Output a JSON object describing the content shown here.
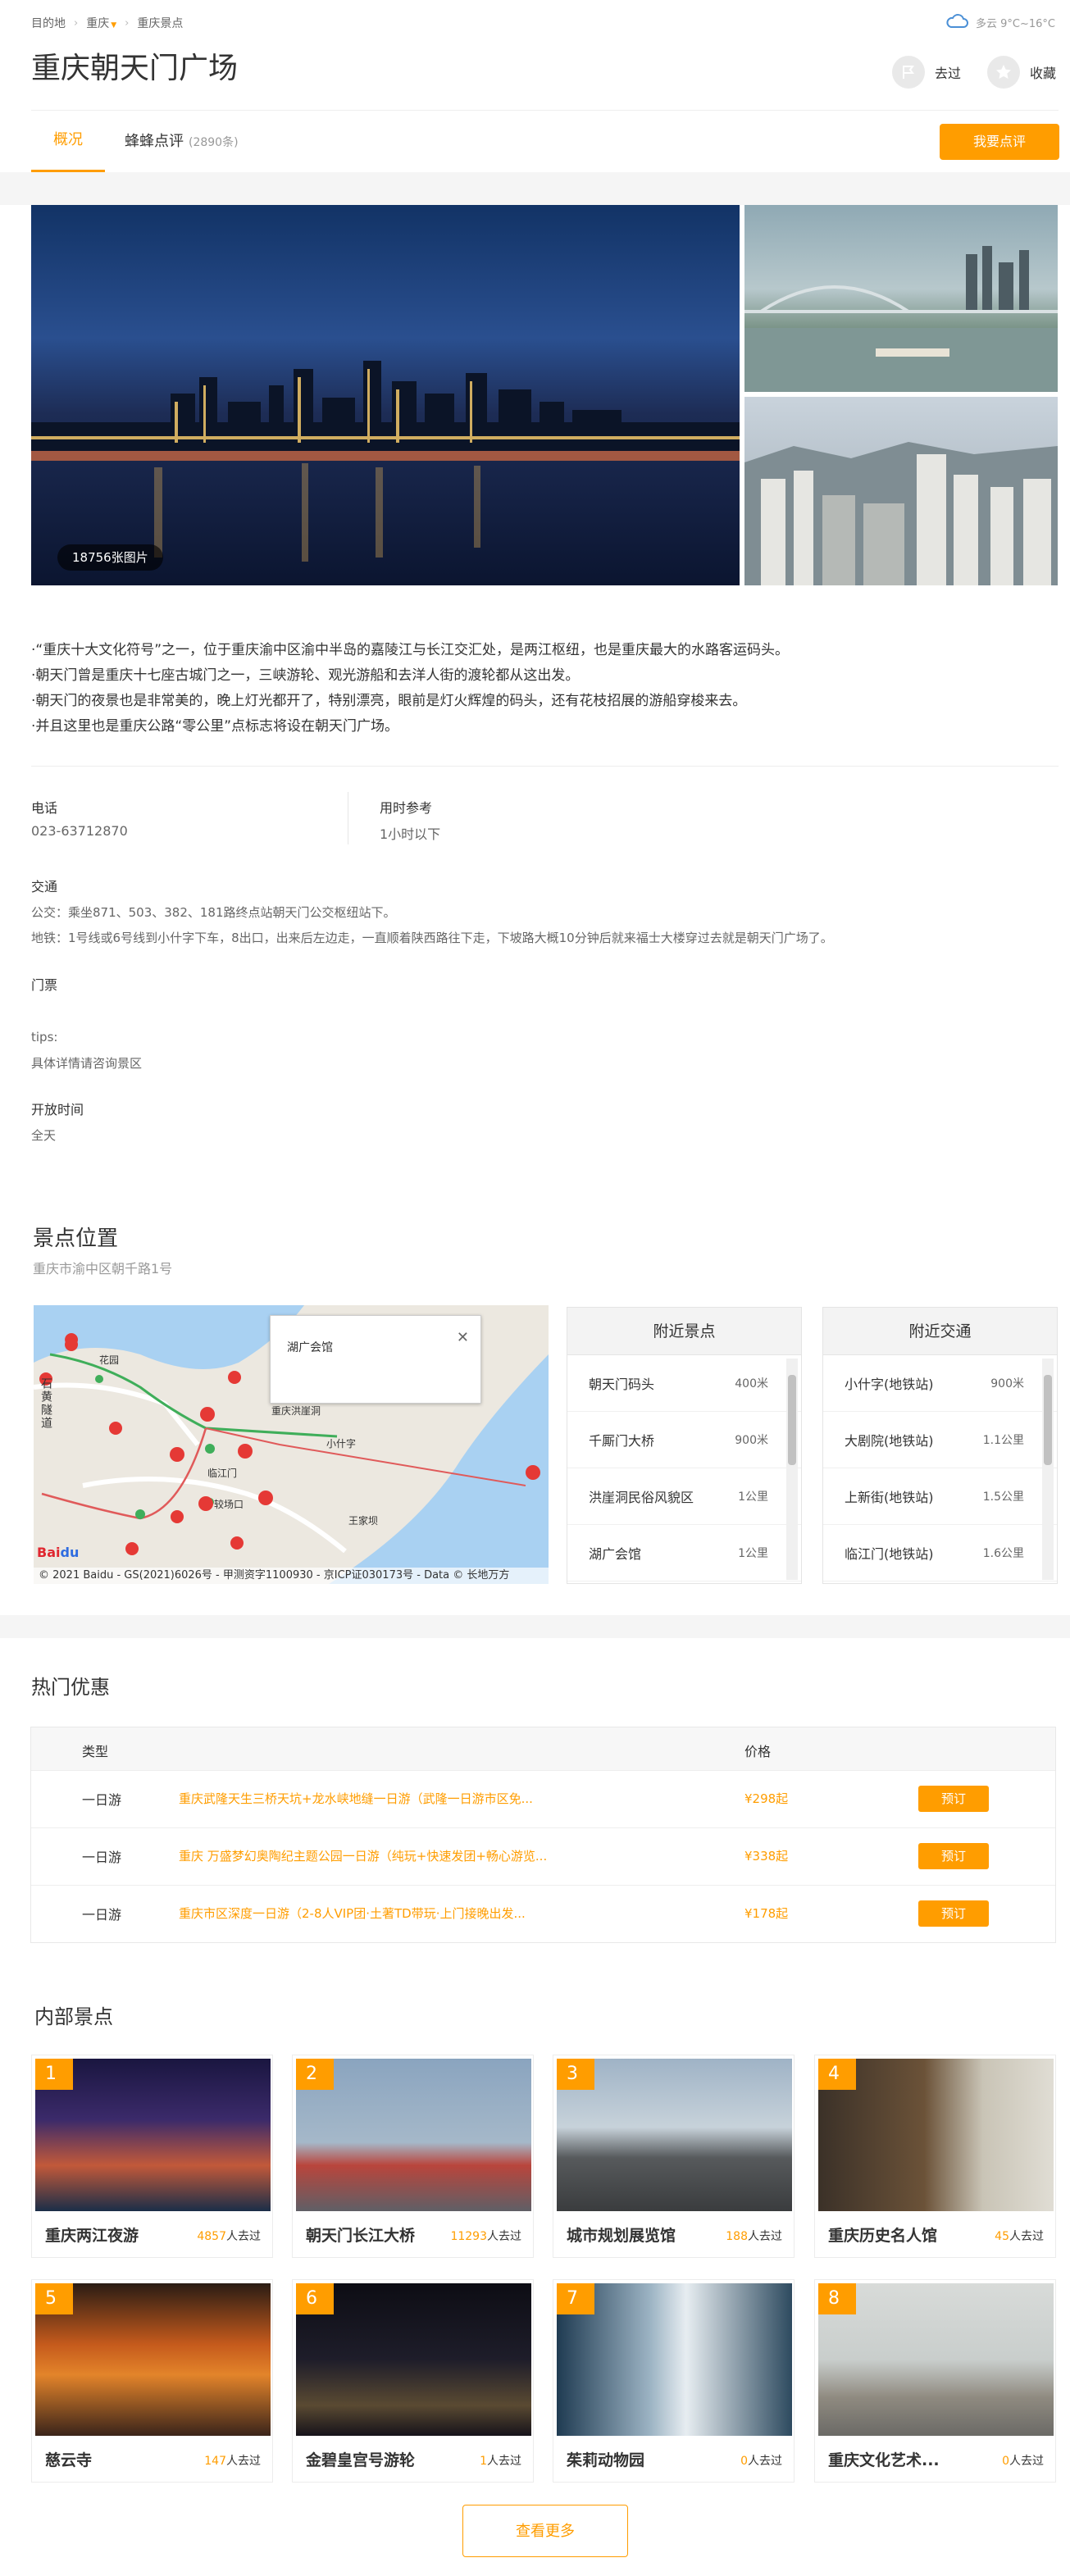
{
  "breadcrumb": {
    "item1": "目的地",
    "item2": "重庆",
    "item3": "重庆景点"
  },
  "weather": {
    "text": "多云 9°C~16°C"
  },
  "page": {
    "title": "重庆朝天门广场"
  },
  "actions": {
    "visited": "去过",
    "favorite": "收藏"
  },
  "tabs": {
    "overview": "概况",
    "reviews": "蜂蜂点评",
    "review_count": "(2890条)",
    "write_review": "我要点评"
  },
  "gallery": {
    "count": "18756张图片"
  },
  "description": [
    "·“重庆十大文化符号”之一，位于重庆渝中区渝中半岛的嘉陵江与长江交汇处，是两江枢纽，也是重庆最大的水路客运码头。",
    "·朝天门曾是重庆十七座古城门之一，三峡游轮、观光游船和去洋人街的渡轮都从这出发。",
    "·朝天门的夜景也是非常美的，晚上灯光都开了，特别漂亮，眼前是灯火辉煌的码头，还有花枝招展的游船穿梭来去。",
    "·并且这里也是重庆公路“零公里”点标志将设在朝天门广场。"
  ],
  "info": {
    "phone_label": "电话",
    "phone": "023-63712870",
    "time_label": "用时参考",
    "time": "1小时以下",
    "transport_label": "交通",
    "bus": "公交：乘坐871、503、382、181路终点站朝天门公交枢纽站下。",
    "metro": "地铁：1号线或6号线到小什字下车，8出口，出来后左边走，一直顺着陕西路往下走，下坡路大概10分钟后就来福士大楼穿过去就是朝天门广场了。",
    "ticket_label": "门票",
    "tips_label": "tips:",
    "tips": "具体详情请咨询景区",
    "hours_label": "开放时间",
    "hours": "全天"
  },
  "location": {
    "title": "景点位置",
    "address": "重庆市渝中区朝千路1号",
    "popup": "湖广会馆",
    "copyright": "© 2021 Baidu - GS(2021)6026号 - 甲测资字1100930 - 京ICP证030173号 - Data © 长地万方",
    "map_labels": {
      "a": "石黄隧道",
      "b": "临江门",
      "c": "较场口",
      "d": "小什字",
      "e": "王家坝",
      "f": "重庆洪崖洞",
      "g": "花园"
    }
  },
  "nearby_spots": {
    "title": "附近景点",
    "items": [
      {
        "name": "朝天门码头",
        "dist": "400米"
      },
      {
        "name": "千厮门大桥",
        "dist": "900米"
      },
      {
        "name": "洪崖洞民俗风貌区",
        "dist": "1公里"
      },
      {
        "name": "湖广会馆",
        "dist": "1公里"
      }
    ]
  },
  "nearby_transit": {
    "title": "附近交通",
    "items": [
      {
        "name": "小什字(地铁站)",
        "dist": "900米"
      },
      {
        "name": "大剧院(地铁站)",
        "dist": "1.1公里"
      },
      {
        "name": "上新街(地铁站)",
        "dist": "1.5公里"
      },
      {
        "name": "临江门(地铁站)",
        "dist": "1.6公里"
      }
    ]
  },
  "deals": {
    "title": "热门优惠",
    "col_type": "类型",
    "col_price": "价格",
    "book_label": "预订",
    "rows": [
      {
        "type": "一日游",
        "name": "重庆武隆天生三桥天坑+龙水峡地缝一日游（武隆一日游市区免...",
        "price": "¥298起"
      },
      {
        "type": "一日游",
        "name": "重庆 万盛梦幻奥陶纪主题公园一日游（纯玩+快速发团+畅心游览...",
        "price": "¥338起"
      },
      {
        "type": "一日游",
        "name": "重庆市区深度一日游（2-8人VIP团·土著TD带玩·上门接晚出发...",
        "price": "¥178起"
      }
    ]
  },
  "inner": {
    "title": "内部景点",
    "visited_suffix": "人去过",
    "more": "查看更多",
    "items": [
      {
        "num": "1",
        "name": "重庆两江夜游",
        "count": "4857"
      },
      {
        "num": "2",
        "name": "朝天门长江大桥",
        "count": "11293"
      },
      {
        "num": "3",
        "name": "城市规划展览馆",
        "count": "188"
      },
      {
        "num": "4",
        "name": "重庆历史名人馆",
        "count": "45"
      },
      {
        "num": "5",
        "name": "慈云寺",
        "count": "147"
      },
      {
        "num": "6",
        "name": "金碧皇宫号游轮",
        "count": "1"
      },
      {
        "num": "7",
        "name": "茱莉动物园",
        "count": "0"
      },
      {
        "num": "8",
        "name": "重庆文化艺术...",
        "count": "0"
      }
    ]
  },
  "colors": {
    "accent": "#ff9d00",
    "text": "#333333",
    "muted": "#999999"
  }
}
